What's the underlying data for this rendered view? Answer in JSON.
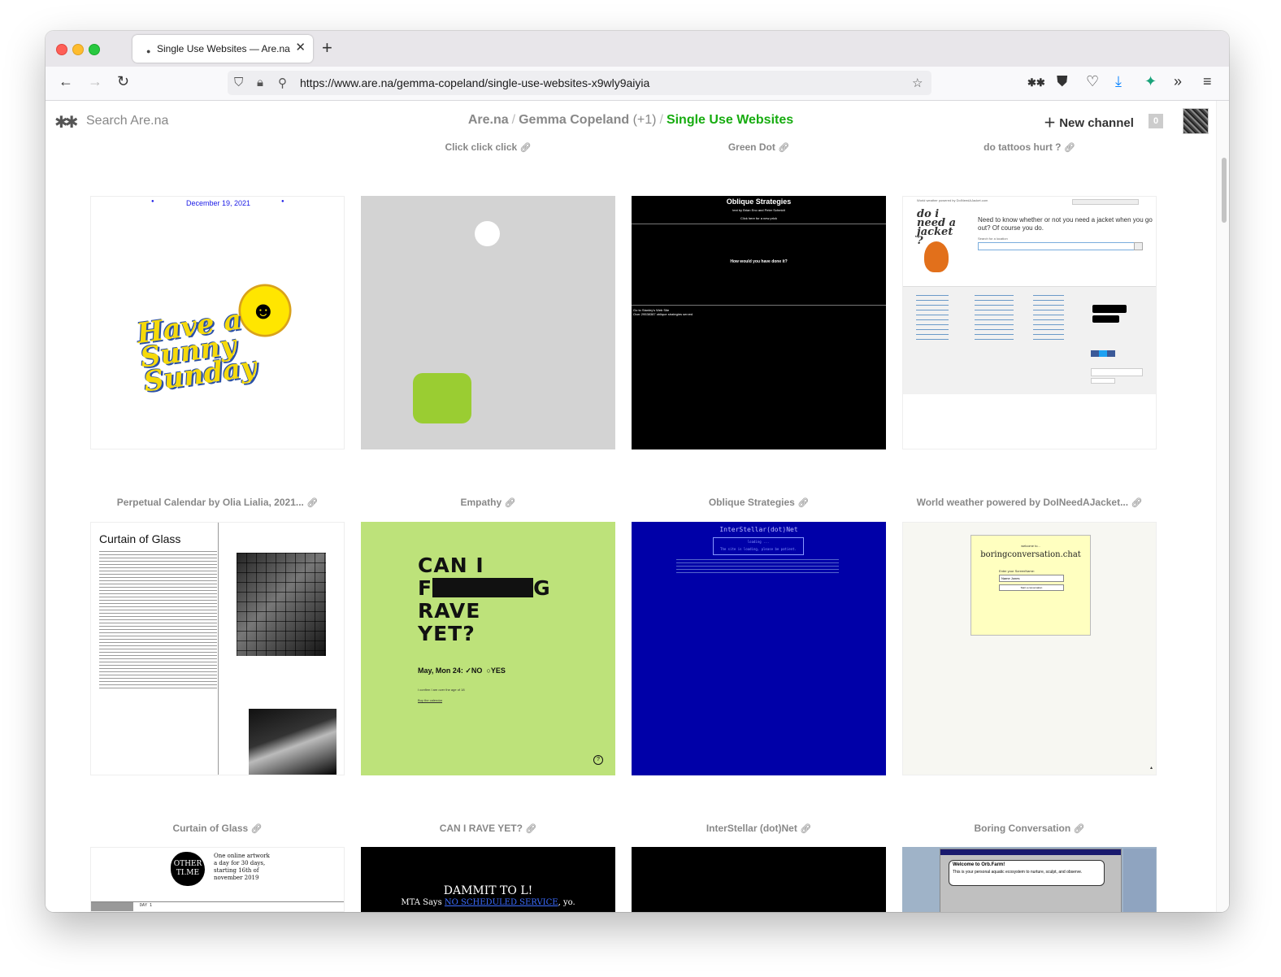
{
  "browser": {
    "tab_title": "Single Use Websites — Are.na",
    "url": "https://www.are.na/gemma-copeland/single-use-websites-x9wly9aiyia"
  },
  "header": {
    "search_placeholder": "Search Are.na",
    "crumb_root": "Are.na",
    "crumb_user": "Gemma Copeland",
    "crumb_count": "(+1)",
    "crumb_channel": "Single Use Websites",
    "new_channel_label": "New channel",
    "notification_count": "0",
    "accent_color": "#17ac10"
  },
  "blocks": {
    "top_captions": [
      "Click click click",
      "Green Dot",
      "do tattoos hurt ?"
    ],
    "row1_captions": [
      "Perpetual Calendar by Olia Lialia, 2021...",
      "Empathy",
      "Oblique Strategies",
      "World weather powered by DoINeedAJacket..."
    ],
    "row2_captions": [
      "Curtain of Glass",
      "CAN I RAVE YET?",
      "InterStellar (dot)Net",
      "Boring Conversation"
    ]
  },
  "thumbs": {
    "calendar_date": "December 19, 2021",
    "sunday_text": "Have a Sunny Sunday",
    "oblique_title": "Oblique Strategies",
    "oblique_byline": "text by Brian Eno and Peter Schmidt",
    "oblique_click": "Click here for a new prick",
    "oblique_question": "How would you have done it?",
    "oblique_footer1": "Go to Stanley's Web Site",
    "oblique_footer2": "Over 29538387 oblique strategies served",
    "jacket_top": "World weather powered by DoINeedAJacket.com",
    "jacket_q": "Need to know whether or not you need a jacket when you go out? Of course you do.",
    "jacket_search_label": "Search for a location",
    "jacket_logo": "do i need a jacket ?",
    "curtain_title": "Curtain of Glass",
    "rave_line1": "CAN I",
    "rave_line2a": "F",
    "rave_line2b": "G",
    "rave_line3": "RAVE",
    "rave_line4": "YET?",
    "rave_date": "May, Mon 24:",
    "rave_no": "NO",
    "rave_yes": "YES",
    "rave_confirm": "I confirm I am over the age of 18",
    "rave_buy": "Buy the calendar",
    "interstellar_title": "InterStellar(dot)Net",
    "interstellar_loading": "loading ...",
    "interstellar_wait": "The site is loading, please be patient.",
    "boring_welcome": "welcome to...",
    "boring_title": "boringconversation.chat",
    "boring_label": "Enter your ScreenName:",
    "boring_input": "Name Jones",
    "boring_button": "Start a conversation",
    "other_text": "One online artwork a day for 30 days, starting 16th of november 2019",
    "other_logo": "OTHER TI.ME",
    "other_day": "DAY 1",
    "mta_title": "DAMMIT TO L!",
    "mta_says": "MTA Says",
    "mta_link": "NO SCHEDULED SERVICE",
    "mta_yo": ", yo.",
    "orb_title": "Welcome to Orb.Farm!",
    "orb_text": "This is your personal aquatic ecosystem to nurture, sculpt, and observe."
  }
}
